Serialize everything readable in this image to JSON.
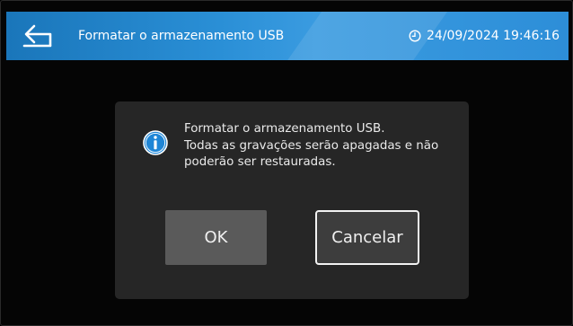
{
  "header": {
    "back_icon": "back-arrow-icon",
    "title": "Formatar o armazenamento USB",
    "clock_icon": "clock-icon",
    "datetime": "24/09/2024 19:46:16"
  },
  "dialog": {
    "icon": "info-icon",
    "message_lines": [
      "Formatar o armazenamento USB.",
      "Todas as gravações serão apagadas e não",
      "poderão ser restauradas."
    ],
    "ok_label": "OK",
    "cancel_label": "Cancelar"
  },
  "colors": {
    "header_blue": "#2a8fd6",
    "dialog_bg": "#262626",
    "ok_button_bg": "#5a5a5a",
    "cancel_button_bg": "#3d3d3d"
  }
}
